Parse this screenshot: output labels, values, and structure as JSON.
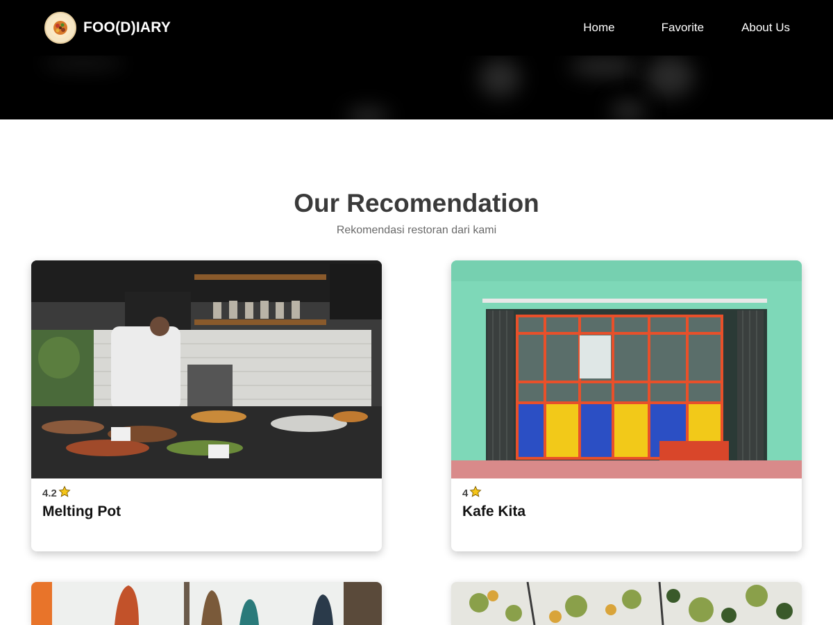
{
  "header": {
    "brand": "FOO(D)IARY",
    "nav": [
      "Home",
      "Favorite",
      "About Us"
    ]
  },
  "section": {
    "title": "Our Recomendation",
    "subtitle": "Rekomendasi restoran dari kami"
  },
  "restaurants": [
    {
      "name": "Melting Pot",
      "rating": "4.2"
    },
    {
      "name": "Kafe Kita",
      "rating": "4"
    }
  ],
  "colors": {
    "header_bg": "#000000",
    "star": "#f5c518",
    "kafe_wall": "#7ed8b8"
  }
}
